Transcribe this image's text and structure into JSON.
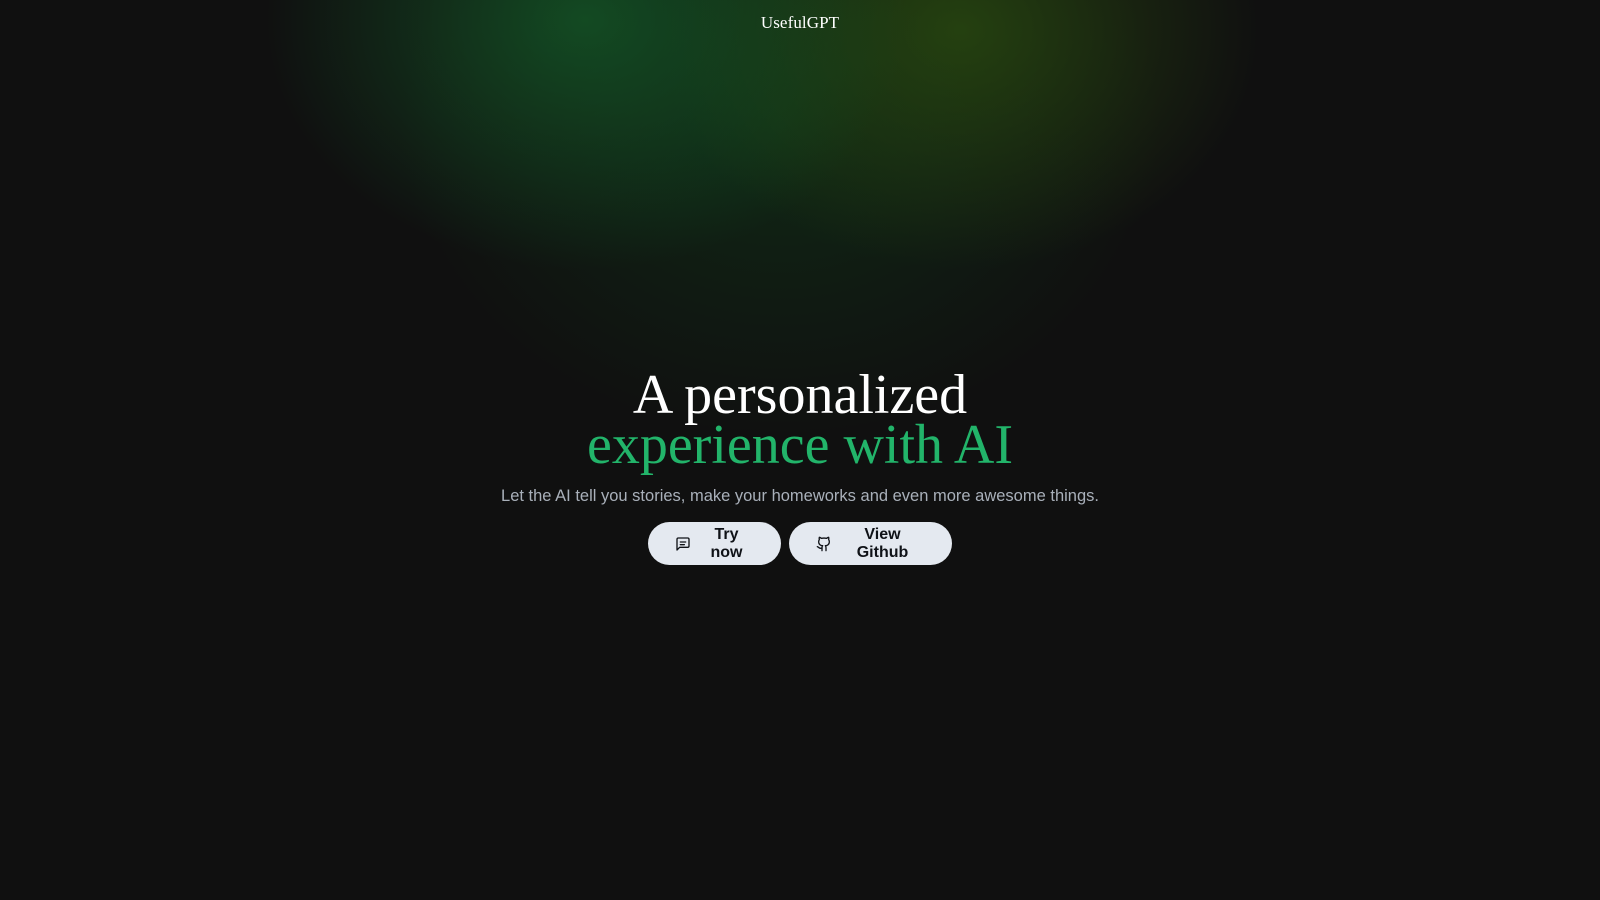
{
  "header": {
    "brand": "UsefulGPT"
  },
  "hero": {
    "title_line1": "A personalized",
    "title_line2": "experience with AI",
    "subtitle": "Let the AI tell you stories, make your homeworks and even more awesome things.",
    "accent_color": "#22b46a"
  },
  "actions": {
    "try_now": {
      "label": "Try now",
      "icon": "message-square-icon"
    },
    "github": {
      "label": "View Github",
      "icon": "github-icon"
    }
  },
  "theme": {
    "background": "#101010",
    "glow_green": "#145a28",
    "button_bg": "#e4e9f0",
    "subtitle_color": "#a9b0ba"
  }
}
